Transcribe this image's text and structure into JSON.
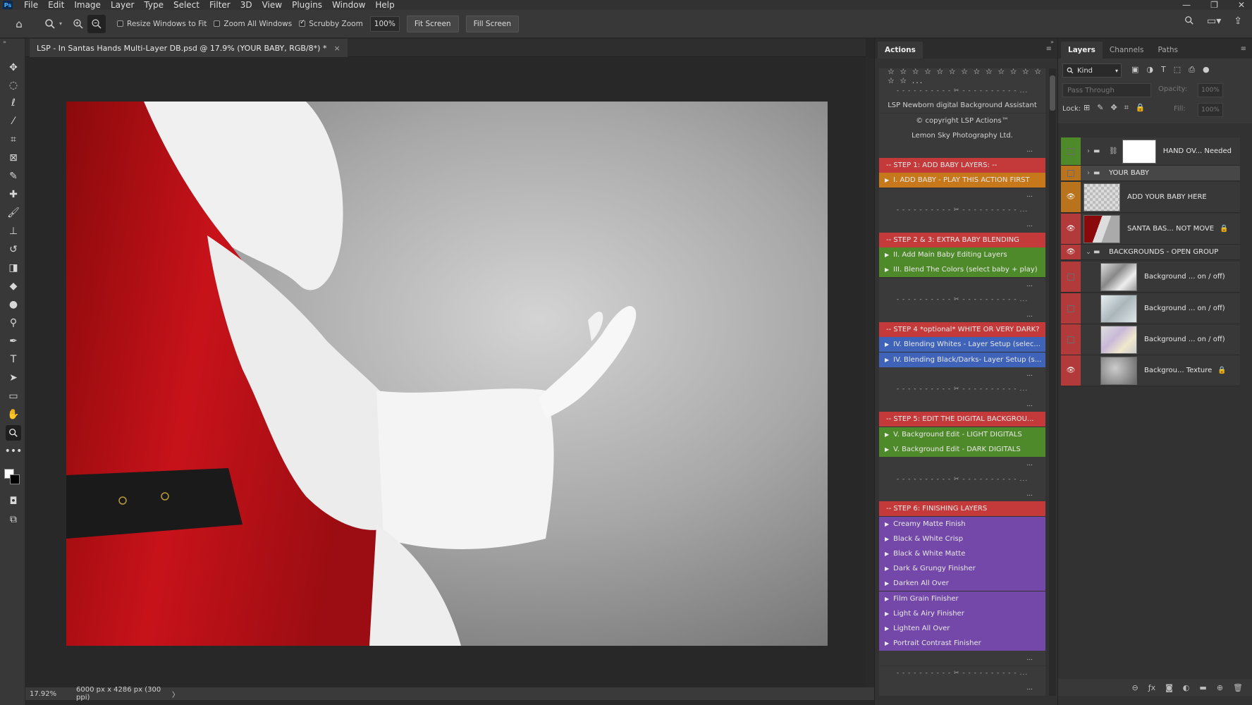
{
  "menubar": {
    "logo": "Ps",
    "items": [
      "File",
      "Edit",
      "Image",
      "Layer",
      "Type",
      "Select",
      "Filter",
      "3D",
      "View",
      "Plugins",
      "Window",
      "Help"
    ],
    "window_controls": [
      "—",
      "❐",
      "✕"
    ]
  },
  "options_bar": {
    "resize_windows_label": "Resize Windows to Fit",
    "resize_windows_checked": false,
    "zoom_all_label": "Zoom All Windows",
    "zoom_all_checked": false,
    "scrubby_zoom_label": "Scrubby Zoom",
    "scrubby_zoom_checked": true,
    "zoom_value": "100%",
    "fit_screen_label": "Fit Screen",
    "fill_screen_label": "Fill Screen"
  },
  "document": {
    "tab_title": "LSP - In Santas Hands Multi-Layer DB.psd @ 17.9% (YOUR BABY, RGB/8*) *",
    "tab_close": "×"
  },
  "status": {
    "zoom": "17.92%",
    "dimensions": "6000 px x 4286 px (300 ppi)",
    "more": "〉"
  },
  "actions_panel": {
    "tab": "Actions",
    "menu": "≡",
    "rows": [
      {
        "kind": "stars",
        "text": "☆ ☆ ☆ ☆ ☆ ☆ ☆ ☆ ☆ ☆ ☆ ☆ ☆ ☆ ☆ ..."
      },
      {
        "kind": "scissor",
        "text": "- - - - - - - - - - ✂ - - - - - - - - - - ..."
      },
      {
        "kind": "plain",
        "text": "LSP Newborn digital Background Assistant"
      },
      {
        "kind": "plain",
        "text": "© copyright LSP Actions™"
      },
      {
        "kind": "plain",
        "text": "Lemon Sky Photography Ltd."
      },
      {
        "kind": "dots",
        "text": "..."
      },
      {
        "kind": "red",
        "text": "-- STEP 1: ADD BABY LAYERS: --"
      },
      {
        "kind": "orange",
        "text": "I. ADD BABY - PLAY THIS ACTION FIRST",
        "play": true
      },
      {
        "kind": "dots",
        "text": "..."
      },
      {
        "kind": "scissor",
        "text": "- - - - - - - - - - ✂ - - - - - - - - - - ..."
      },
      {
        "kind": "dots",
        "text": "..."
      },
      {
        "kind": "red",
        "text": "-- STEP 2 & 3: EXTRA BABY BLENDING"
      },
      {
        "kind": "green",
        "text": "II.  Add Main Baby Editing Layers",
        "play": true
      },
      {
        "kind": "green",
        "text": "III. Blend The Colors (select baby + play)",
        "play": true
      },
      {
        "kind": "dots",
        "text": "..."
      },
      {
        "kind": "scissor",
        "text": "- - - - - - - - - - ✂ - - - - - - - - - - ..."
      },
      {
        "kind": "dots",
        "text": "..."
      },
      {
        "kind": "red",
        "text": "-- STEP 4 *optional* WHITE OR VERY DARK?"
      },
      {
        "kind": "blue",
        "text": "IV. Blending Whites - Layer Setup (selec...",
        "play": true
      },
      {
        "kind": "blue",
        "text": "IV. Blending Black/Darks- Layer Setup (s...",
        "play": true
      },
      {
        "kind": "dots",
        "text": "..."
      },
      {
        "kind": "scissor",
        "text": "- - - - - - - - - - ✂ - - - - - - - - - - ..."
      },
      {
        "kind": "dots",
        "text": "..."
      },
      {
        "kind": "red",
        "text": "-- STEP 5: EDIT THE DIGITAL BACKGROU..."
      },
      {
        "kind": "green",
        "text": "V. Background Edit - LIGHT DIGITALS",
        "play": true
      },
      {
        "kind": "green",
        "text": "V. Background Edit - DARK DIGITALS",
        "play": true
      },
      {
        "kind": "dots",
        "text": "..."
      },
      {
        "kind": "scissor",
        "text": "- - - - - - - - - - ✂ - - - - - - - - - - ..."
      },
      {
        "kind": "dots",
        "text": "..."
      },
      {
        "kind": "red",
        "text": "-- STEP 6: FINISHING LAYERS"
      },
      {
        "kind": "purple",
        "text": "Creamy Matte Finish",
        "play": true
      },
      {
        "kind": "purple",
        "text": "Black & White Crisp",
        "play": true
      },
      {
        "kind": "purple",
        "text": "Black & White Matte",
        "play": true
      },
      {
        "kind": "purple",
        "text": "Dark & Grungy Finisher",
        "play": true
      },
      {
        "kind": "purple",
        "text": "Darken All Over",
        "play": true
      },
      {
        "kind": "purple",
        "text": "Film Grain Finisher",
        "play": true
      },
      {
        "kind": "purple",
        "text": "Light & Airy Finisher",
        "play": true
      },
      {
        "kind": "purple",
        "text": "Lighten All Over",
        "play": true
      },
      {
        "kind": "purple",
        "text": "Portrait Contrast Finisher",
        "play": true
      },
      {
        "kind": "dots",
        "text": "..."
      },
      {
        "kind": "scissor",
        "text": "- - - - - - - - - - ✂ - - - - - - - - - - ..."
      },
      {
        "kind": "dots",
        "text": "..."
      }
    ]
  },
  "layers_panel": {
    "tabs": [
      "Layers",
      "Channels",
      "Paths"
    ],
    "menu": "≡",
    "kind_label": "Kind",
    "blend_mode": "Pass Through",
    "opacity_label": "Opacity:",
    "opacity_value": "100%",
    "lock_label": "Lock:",
    "fill_label": "Fill:",
    "fill_value": "100%",
    "layers": [
      {
        "name": "HAND OV... Needed",
        "vis": "green",
        "visible": false,
        "group": true,
        "chain": true
      },
      {
        "name": "YOUR BABY",
        "vis": "orange",
        "visible": false,
        "group": true,
        "selected": true
      },
      {
        "name": "ADD YOUR BABY HERE",
        "vis": "orange",
        "visible": true
      },
      {
        "name": "SANTA BAS... NOT MOVE",
        "vis": "red",
        "visible": true,
        "locked": true
      },
      {
        "name": "BACKGROUNDS - OPEN GROUP",
        "vis": "red",
        "visible": true,
        "group": true,
        "open": true
      },
      {
        "name": "Background ... on / off)",
        "vis": "red",
        "visible": false
      },
      {
        "name": "Background ... on / off)",
        "vis": "red",
        "visible": false
      },
      {
        "name": "Background ... on / off)",
        "vis": "red",
        "visible": false
      },
      {
        "name": "Backgrou... Texture",
        "vis": "red",
        "visible": true,
        "locked": true
      }
    ],
    "bottom_icons": [
      "link-icon",
      "fx-icon",
      "mask-icon",
      "adjustment-icon",
      "folder-icon",
      "new-layer-icon",
      "trash-icon"
    ]
  }
}
